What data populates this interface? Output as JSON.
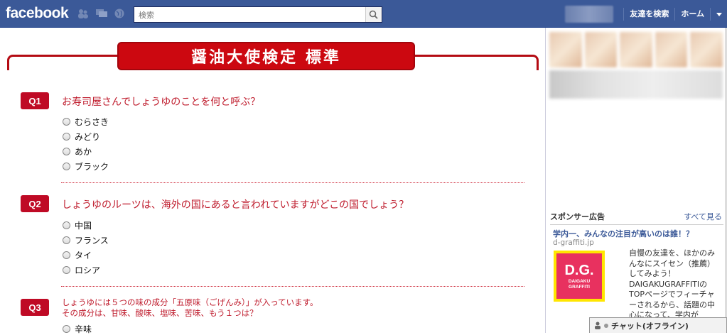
{
  "header": {
    "logo": "facebook",
    "search_placeholder": "検索",
    "find_friends": "友達を検索",
    "home": "ホーム"
  },
  "quiz": {
    "title": "醤油大使検定 標準",
    "questions": [
      {
        "badge": "Q1",
        "text": "お寿司屋さんでしょうゆのことを何と呼ぶ？",
        "options": [
          "むらさき",
          "みどり",
          "あか",
          "ブラック"
        ]
      },
      {
        "badge": "Q2",
        "text": "しょうゆのルーツは、海外の国にあると言われていますがどこの国でしょう？",
        "options": [
          "中国",
          "フランス",
          "タイ",
          "ロシア"
        ]
      },
      {
        "badge": "Q3",
        "text_line1": "しょうゆには５つの味の成分「五原味（ごげんみ）」が入っています。",
        "text_line2": "その成分は、甘味、酸味、塩味、苦味、もう１つは？",
        "options": [
          "辛味"
        ]
      }
    ]
  },
  "sidebar": {
    "sponsored_label": "スポンサー広告",
    "see_all": "すべて見る",
    "ad": {
      "title": "学内一、みんなの注目が高いのは誰！？",
      "url": "d-graffiti.jp",
      "image_text_big": "D.G.",
      "image_text_small1": "DAIGAKU",
      "image_text_small2": "GRAFFITI",
      "body": "自慢の友達を、ほかのみんなにスイセン（推薦）してみよう！DAIGAKUGRAFFITIのTOPページでフィーチャーされるから、話題の中心になって、学内が"
    }
  },
  "chat": {
    "label": "チャット(オフライン)"
  },
  "colors": {
    "fb_blue": "#3b5998",
    "quiz_red": "#bf0a25",
    "banner_red": "#cc0810"
  }
}
